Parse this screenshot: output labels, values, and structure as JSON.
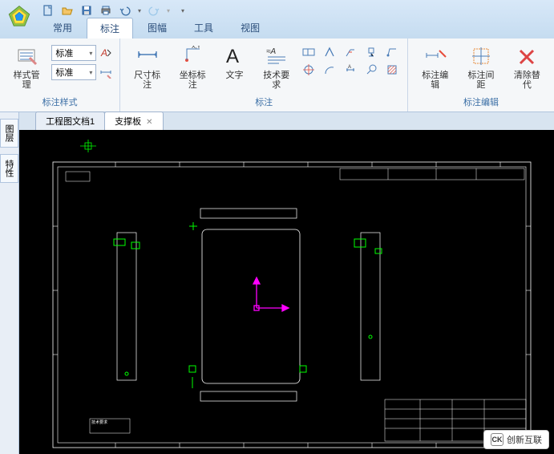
{
  "qat": {
    "new_tip": "新建",
    "open_tip": "打开",
    "save_tip": "保存",
    "print_tip": "打印",
    "undo_tip": "撤销",
    "redo_tip": "重做"
  },
  "tabs": {
    "common": "常用",
    "annotation": "标注",
    "drawing": "图幅",
    "tools": "工具",
    "view": "视图"
  },
  "ribbon": {
    "style_manage": "样式管理",
    "combo1": "标准",
    "combo2": "标准",
    "group_style": "标注样式",
    "dim_annotate": "尺寸标注",
    "coord_annotate": "坐标标注",
    "text": "文字",
    "tech_req": "技术要求",
    "group_annotate": "标注",
    "annot_edit": "标注编辑",
    "annot_spacing": "标注间距",
    "clear_replace": "清除替代",
    "group_edit": "标注编辑"
  },
  "doc_tabs": {
    "tab1": "工程图文档1",
    "tab2": "支撑板"
  },
  "left_panels": {
    "p1": "图层",
    "p2": "特性"
  },
  "watermark": {
    "text": "创新互联",
    "badge": "CK"
  },
  "colors": {
    "ribbon_bg": "#f5f7f9",
    "titlebar_bg": "#d0e2f4",
    "canvas_bg": "#000000",
    "drawing_line": "#ffffff",
    "drawing_green": "#00ff00",
    "drawing_magenta": "#ff00ff"
  }
}
